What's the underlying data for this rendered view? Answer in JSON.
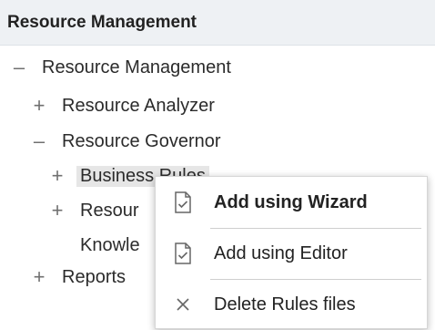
{
  "header": {
    "title": "Resource Management"
  },
  "tree": {
    "root": {
      "toggle": "–",
      "label": "Resource Management"
    },
    "analyzer": {
      "toggle": "+",
      "label": "Resource Analyzer"
    },
    "governor": {
      "toggle": "–",
      "label": "Resource Governor"
    },
    "business_rules": {
      "toggle": "+",
      "label": "Business Rules"
    },
    "resource_partial": {
      "toggle": "+",
      "label": "Resour"
    },
    "knowledge_partial": {
      "label": "Knowle"
    },
    "reports": {
      "toggle": "+",
      "label": "Reports"
    }
  },
  "context_menu": {
    "items": [
      {
        "label": "Add using Wizard",
        "icon": "document-check-icon",
        "bold": true
      },
      {
        "label": "Add using Editor",
        "icon": "document-check-icon",
        "bold": false
      },
      {
        "label": "Delete Rules files",
        "icon": "close-icon",
        "bold": false
      }
    ]
  }
}
